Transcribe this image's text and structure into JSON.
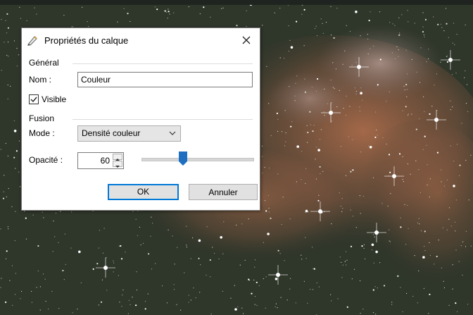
{
  "background": {
    "image_name": "nebula-starfield",
    "nebula_color": "#b8714e",
    "sky_color": "#2f362a"
  },
  "dialog": {
    "title": "Propriétés du calque",
    "icon": "layer-properties-icon",
    "close_icon": "close-icon",
    "general": {
      "group_label": "Général",
      "name_label": "Nom :",
      "name_value": "Couleur",
      "visible_label": "Visible",
      "visible_checked": true
    },
    "fusion": {
      "group_label": "Fusion",
      "mode_label": "Mode :",
      "mode_value": "Densité couleur",
      "opacity_label": "Opacité :",
      "opacity_value": "60",
      "opacity_percent": 60
    },
    "buttons": {
      "ok": "OK",
      "cancel": "Annuler"
    },
    "colors": {
      "accent": "#0078d7",
      "thumb": "#1e6fbf"
    }
  }
}
